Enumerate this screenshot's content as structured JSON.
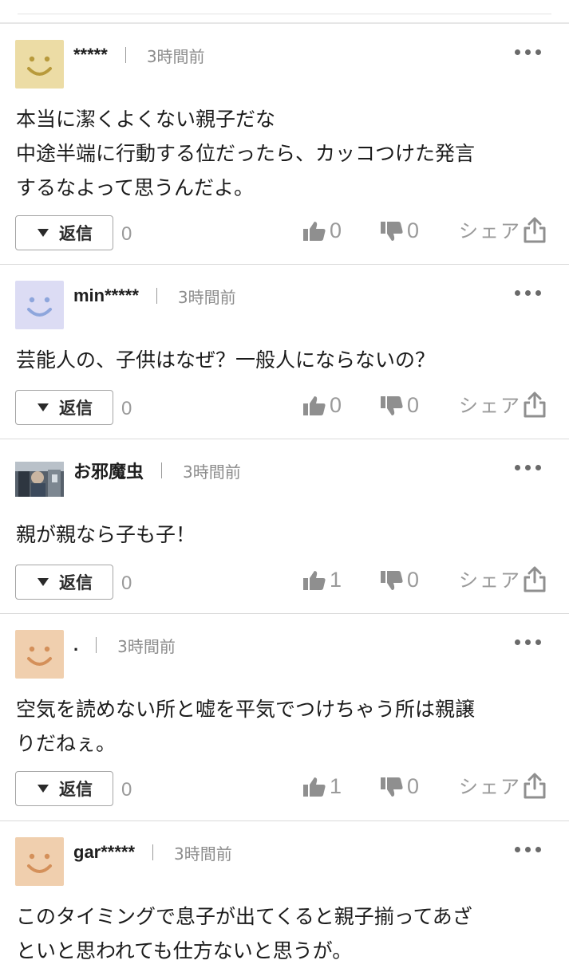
{
  "ui": {
    "reply_label": "返信",
    "share_label": "シェア"
  },
  "comments": [
    {
      "username": "*****",
      "time": "3時間前",
      "avatar": "smiley-yellow",
      "lines": [
        "本当に潔くよくない親子だな",
        "中途半端に行動する位だったら、カッコつけた発言",
        "するなよって思うんだよ。"
      ],
      "reply_count": "0",
      "likes": "0",
      "dislikes": "0"
    },
    {
      "username": "min*****",
      "time": "3時間前",
      "avatar": "smiley-blue",
      "lines": [
        "芸能人の、子供はなぜ？一般人にならないの？"
      ],
      "reply_count": "0",
      "likes": "0",
      "dislikes": "0"
    },
    {
      "username": "お邪魔虫",
      "time": "3時間前",
      "avatar": "photo",
      "lines": [
        "親が親なら子も子！"
      ],
      "reply_count": "0",
      "likes": "1",
      "dislikes": "0"
    },
    {
      "username": ".",
      "time": "3時間前",
      "avatar": "smiley-orange",
      "lines": [
        "空気を読めない所と嘘を平気でつけちゃう所は親譲",
        "りだねぇ。"
      ],
      "reply_count": "0",
      "likes": "1",
      "dislikes": "0"
    },
    {
      "username": "gar*****",
      "time": "3時間前",
      "avatar": "smiley-orange",
      "lines": [
        "このタイミングで息子が出てくると親子揃ってあざ",
        "といと思われても仕方ないと思うが。"
      ]
    }
  ],
  "colors": {
    "smiley-yellow": {
      "bg": "#ecdca5",
      "fg": "#b89a3c"
    },
    "smiley-blue": {
      "bg": "#dcdcf4",
      "fg": "#8ea6dc"
    },
    "smiley-orange": {
      "bg": "#f0cfae",
      "fg": "#d4905a"
    }
  }
}
